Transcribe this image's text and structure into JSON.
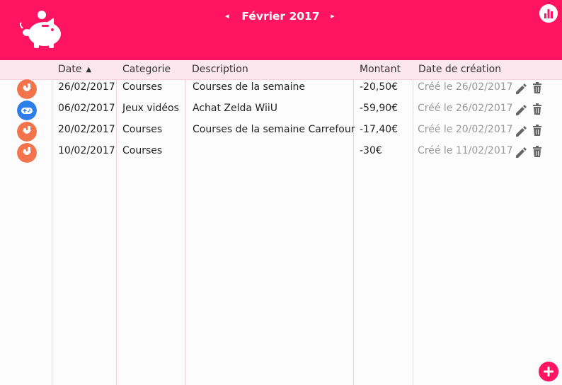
{
  "header": {
    "month_title": "Février 2017",
    "prev_arrow": "◂",
    "next_arrow": "▸",
    "brand_color": "#ff1461"
  },
  "table": {
    "columns": {
      "date": "Date",
      "date_sort": "▲",
      "category": "Categorie",
      "description": "Description",
      "amount": "Montant",
      "created": "Date de création"
    },
    "rows": [
      {
        "icon": "groceries-icon",
        "icon_color": "#f2734c",
        "date": "26/02/2017",
        "category": "Courses",
        "description": "Courses de la semaine",
        "amount": "-20,50€",
        "created": "Créé le 26/02/2017"
      },
      {
        "icon": "gamepad-icon",
        "icon_color": "#2d7ee8",
        "date": "06/02/2017",
        "category": "Jeux vidéos",
        "description": "Achat Zelda WiiU",
        "amount": "-59,90€",
        "created": "Créé le 26/02/2017"
      },
      {
        "icon": "groceries-icon",
        "icon_color": "#f2734c",
        "date": "20/02/2017",
        "category": "Courses",
        "description": "Courses de la semaine Carrefour",
        "amount": "-17,40€",
        "created": "Créé le 20/02/2017"
      },
      {
        "icon": "groceries-icon",
        "icon_color": "#f2734c",
        "date": "10/02/2017",
        "category": "Courses",
        "description": "",
        "amount": "-30€",
        "created": "Créé le 11/02/2017"
      }
    ]
  },
  "icons": {
    "logo": "piggy-bank-icon",
    "stats": "bar-chart-icon",
    "edit": "pencil-icon",
    "delete": "trash-icon",
    "add": "plus-icon"
  }
}
